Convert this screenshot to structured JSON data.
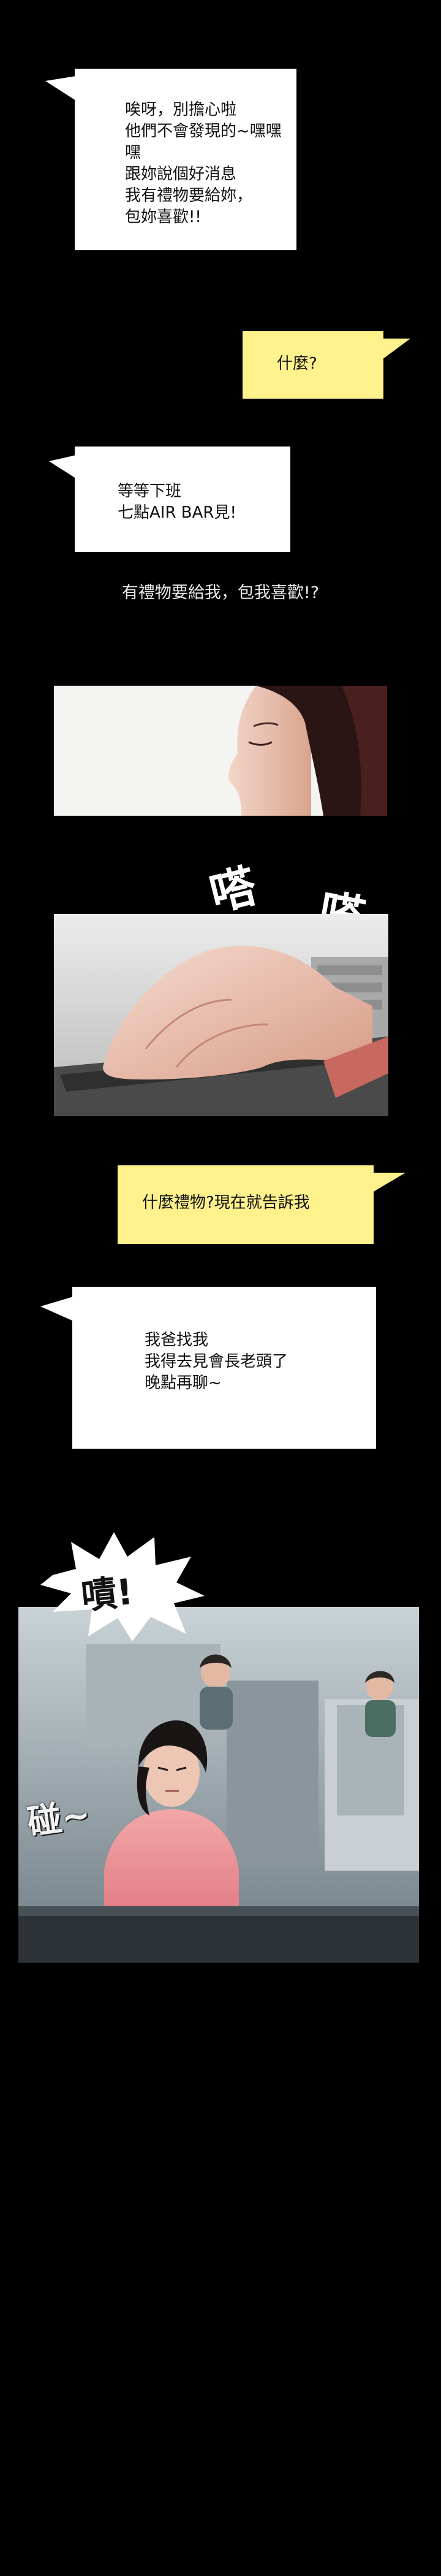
{
  "bubbles": {
    "b1": "唉呀，別擔心啦\n他們不會發現的~嘿嘿嘿\n跟妳說個好消息\n我有禮物要給妳，\n包妳喜歡!!",
    "b2": "什麼?",
    "b3": "等等下班\n七點AIR BAR見!",
    "b4": "什麼禮物?現在就告訴我",
    "b5": "我爸找我\n我得去見會長老頭了\n晚點再聊~"
  },
  "narration": "有禮物要給我，包我喜歡!?",
  "sfx": {
    "tap1": "嗒",
    "tap2": "嗒，",
    "tsk": "嘖!",
    "bang": "碰~"
  },
  "colors": {
    "background": "#000000",
    "bubble_white": "#ffffff",
    "bubble_yellow": "#fff18c"
  }
}
